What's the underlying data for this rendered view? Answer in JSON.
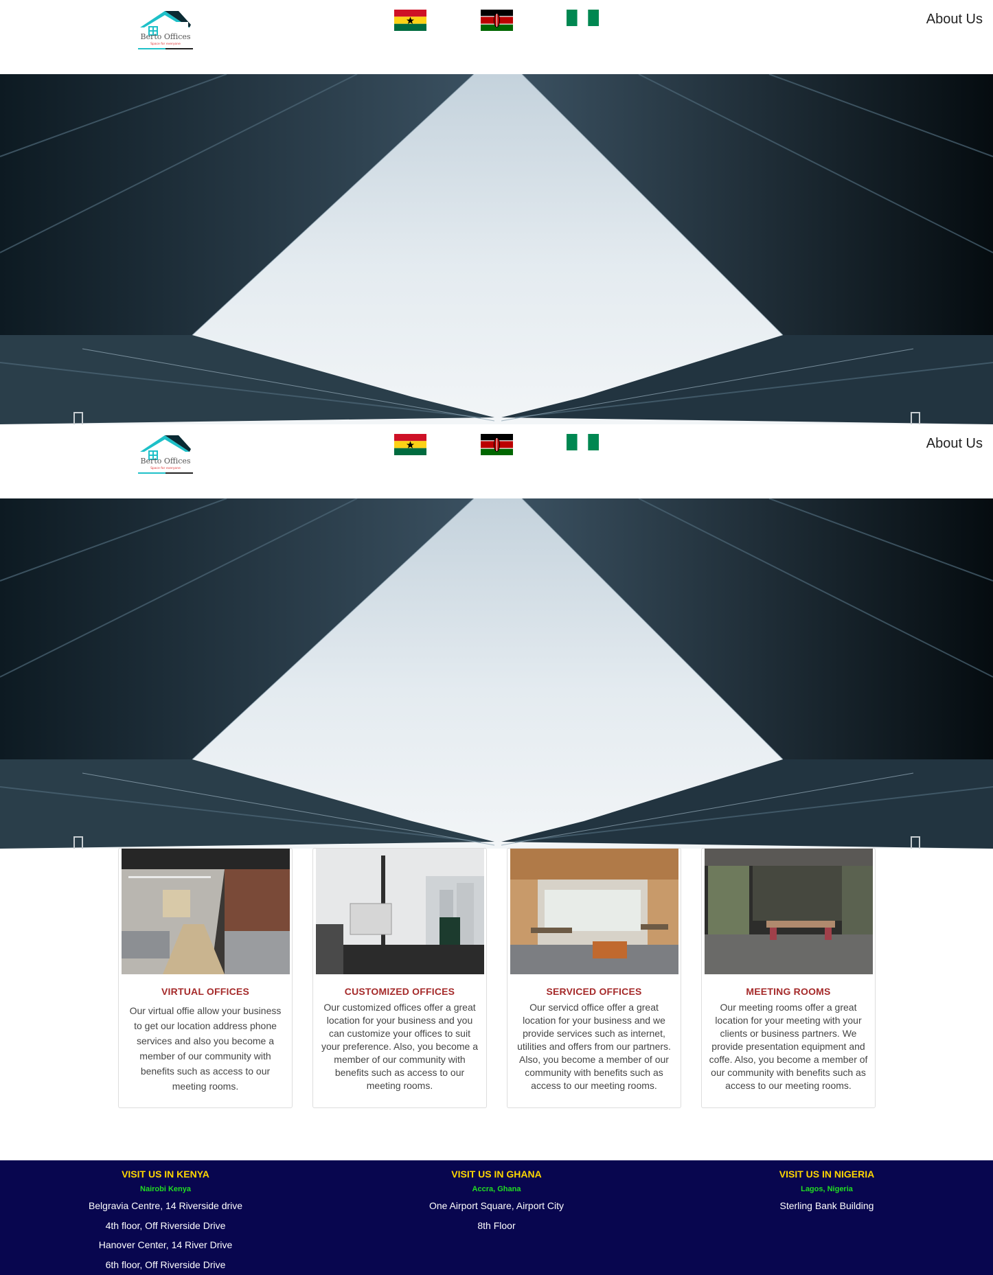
{
  "header": {
    "logo_name": "Berto Offices",
    "logo_tagline": "Space for everyone",
    "flags": [
      "ghana-flag",
      "kenya-flag",
      "nigeria-flag"
    ],
    "about_label": "About Us"
  },
  "services": [
    {
      "title": "VIRTUAL OFFICES",
      "text": "Our virtual offie allow your business to get our location address phone services and also you become a member of our community with benefits such as access to our meeting rooms."
    },
    {
      "title": "CUSTOMIZED OFFICES",
      "text": "Our customized offices offer a great location for your business and you can customize your offices to suit your preference. Also, you become a member of our community with benefits such as access to our meeting rooms."
    },
    {
      "title": "SERVICED OFFICES",
      "text": "Our servicd office offer a great location for your business and we provide services such as internet, utilities and offers from our partners. Also, you become a member of our community with benefits such as access to our meeting rooms."
    },
    {
      "title": "MEETING ROOMS",
      "text": "Our meeting rooms offer a great location for your meeting with your clients or business partners. We provide presentation equipment and coffe. Also, you become a member of our community with benefits such as access to our meeting rooms."
    }
  ],
  "footer": {
    "kenya": {
      "heading": "VISIT US IN KENYA",
      "city": "Nairobi Kenya",
      "lines": [
        "Belgravia Centre, 14 Riverside drive",
        "4th floor, Off Riverside Drive",
        "Hanover Center, 14 River Drive",
        "6th floor, Off Riverside Drive"
      ]
    },
    "ghana": {
      "heading": "VISIT US IN GHANA",
      "city": "Accra, Ghana",
      "lines": [
        "One Airport Square, Airport City",
        "8th Floor"
      ]
    },
    "nigeria": {
      "heading": "VISIT US IN NIGERIA",
      "city": "Lagos, Nigeria",
      "lines": [
        "Sterling Bank Building"
      ]
    }
  },
  "colors": {
    "footer_bg": "#08064f",
    "footer_heading": "#ffd700",
    "footer_city": "#22dd22",
    "card_title": "#a52a2a"
  }
}
